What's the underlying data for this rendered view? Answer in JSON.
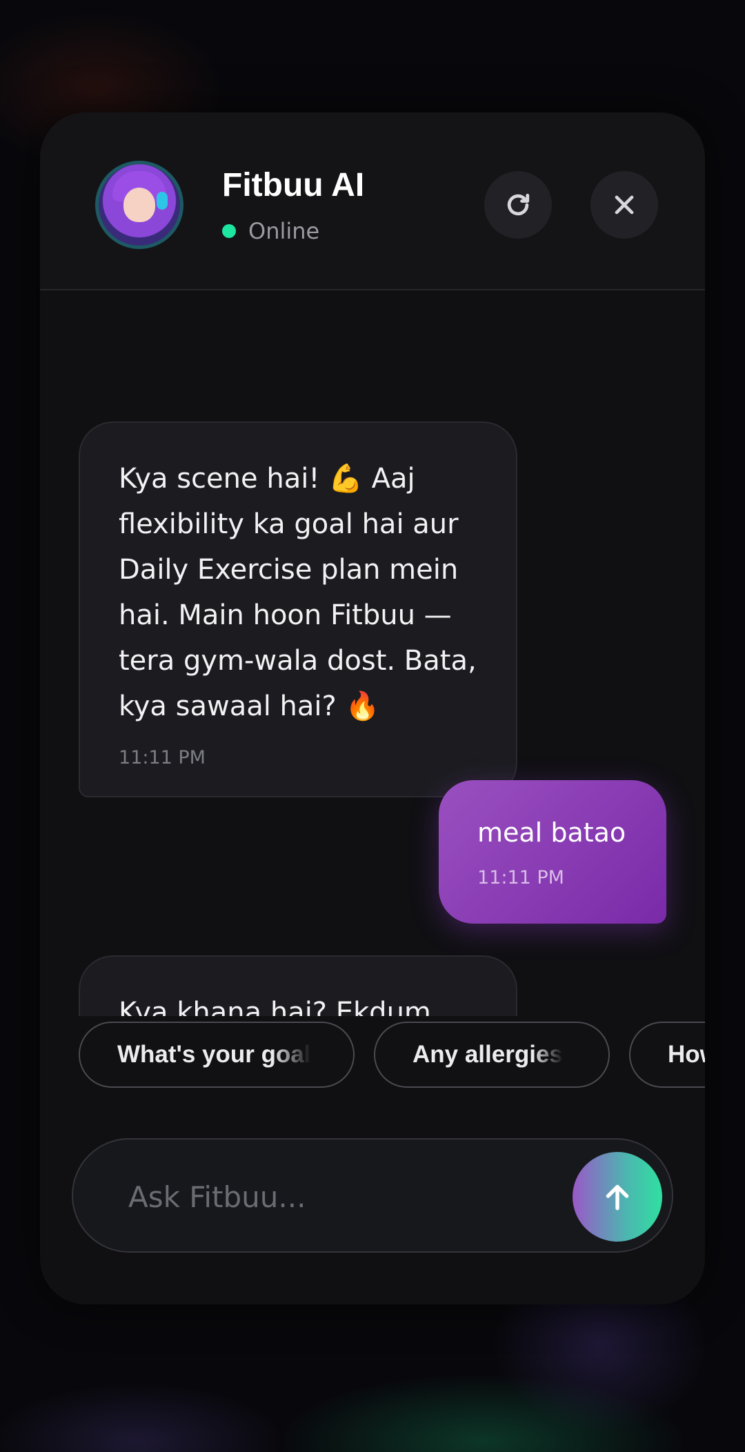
{
  "header": {
    "title": "Fitbuu AI",
    "status": "Online",
    "avatar_icon": "anime-girl-headset-avatar",
    "refresh_icon": "refresh-icon",
    "close_icon": "close-icon"
  },
  "messages": [
    {
      "role": "assistant",
      "text": "Kya scene hai! 💪 Aaj flexibility ka goal hai aur Daily Exercise plan mein hai. Main hoon Fitbuu — tera gym-wala dost. Bata, kya sawaal hai? 🔥",
      "time": "11:11 PM"
    },
    {
      "role": "user",
      "text": "meal batao",
      "time": "11:11 PM"
    },
    {
      "role": "assistant",
      "text": "Kya khana hai? Ekdum halka-phulka ya thoda heavy? Batao zara, main tera personal chef"
    }
  ],
  "suggestions": [
    "What's your goal",
    "Any allergies",
    "How"
  ],
  "composer": {
    "placeholder": "Ask Fitbuu...",
    "value": "",
    "send_icon": "arrow-up-icon"
  },
  "colors": {
    "online": "#1de6a0",
    "user_bubble": "#8a3cb8",
    "send_gradient_start": "#9a58c8",
    "send_gradient_end": "#2fe0a0"
  }
}
